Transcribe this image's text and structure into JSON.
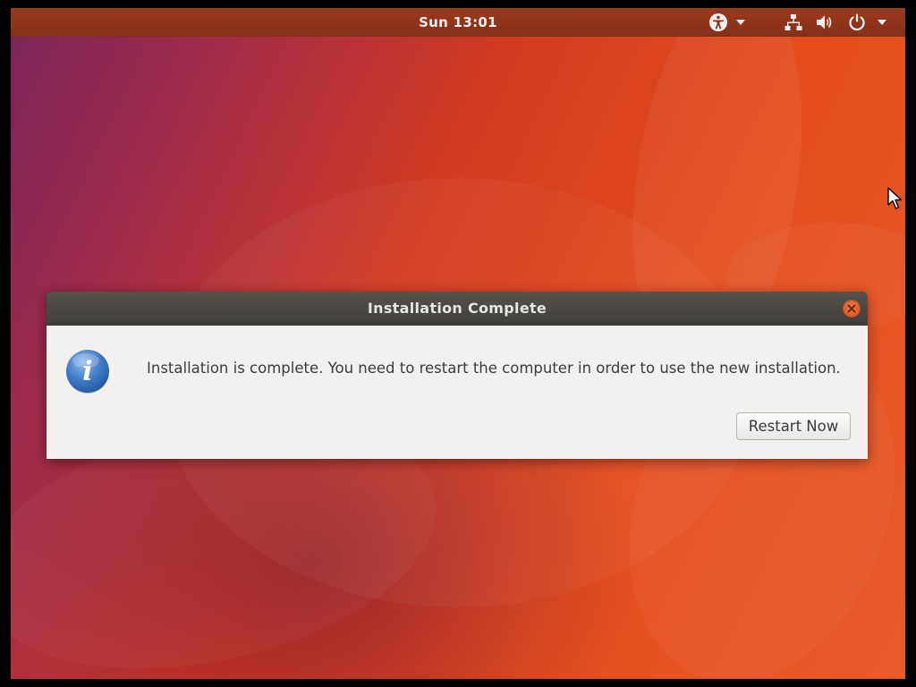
{
  "top_panel": {
    "clock": "Sun 13:01",
    "icons": [
      "accessibility-icon",
      "dropdown-arrow-icon",
      "network-icon",
      "volume-icon",
      "power-icon",
      "dropdown-arrow-icon"
    ]
  },
  "dialog": {
    "title": "Installation Complete",
    "icon": "info-icon",
    "message": "Installation is complete. You need to restart the computer in order to use the new installation.",
    "restart_button": "Restart Now"
  },
  "colors": {
    "wallpaper_orange": "#e64d1e",
    "wallpaper_purple": "#7a2458",
    "close_button": "#e0602e",
    "titlebar": "#4a4844"
  }
}
